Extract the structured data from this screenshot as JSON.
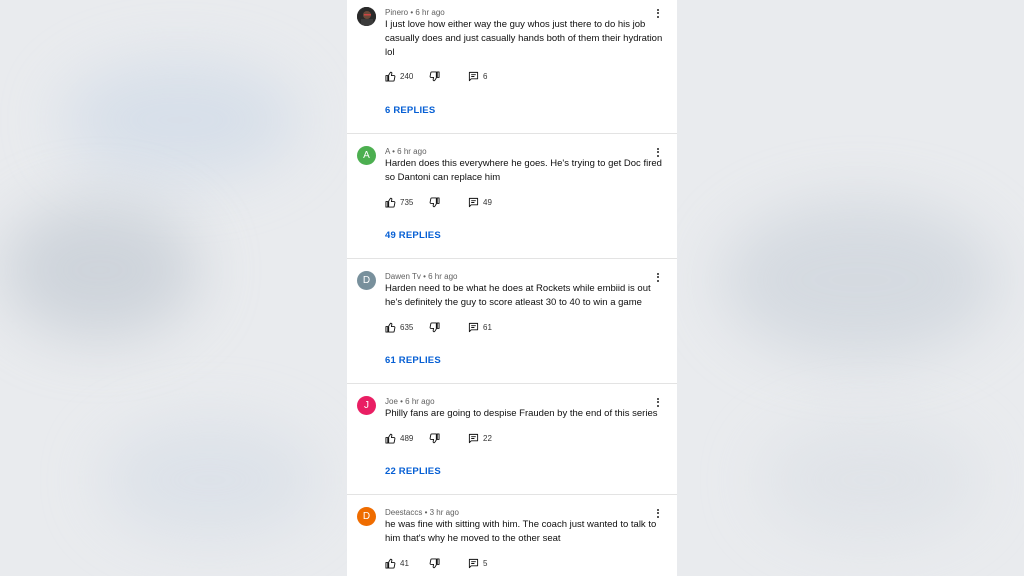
{
  "comments": [
    {
      "author": "Pinero",
      "time": "6 hr ago",
      "text": "I just love how either way the guy whos just there to do his job casually does and just casually hands both of them their hydration lol",
      "likes": "240",
      "reply_count": "6",
      "replies_label": "6 REPLIES",
      "avatar_letter": "",
      "avatar_color": "#2b2b2b"
    },
    {
      "author": "A",
      "time": "6 hr ago",
      "text": "Harden does this everywhere he goes. He's trying to get Doc fired so Dantoni can replace him",
      "likes": "735",
      "reply_count": "49",
      "replies_label": "49 REPLIES",
      "avatar_letter": "A",
      "avatar_color": "#4caf50"
    },
    {
      "author": "Dawen Tv",
      "time": "6 hr ago",
      "text": "Harden need to be what he does at Rockets while embiid is out he's definitely the guy to score atleast 30 to 40 to win a game",
      "likes": "635",
      "reply_count": "61",
      "replies_label": "61 REPLIES",
      "avatar_letter": "D",
      "avatar_color": "#78909c"
    },
    {
      "author": "Joe",
      "time": "6 hr ago",
      "text": "Philly fans are going to despise Frauden by the end of this series",
      "likes": "489",
      "reply_count": "22",
      "replies_label": "22 REPLIES",
      "avatar_letter": "J",
      "avatar_color": "#e91e63"
    },
    {
      "author": "Deestaccs",
      "time": "3 hr ago",
      "text": "he was fine with sitting with him. The coach just wanted to talk to him that's why he moved to the other seat",
      "likes": "41",
      "reply_count": "5",
      "avatar_letter": "D",
      "avatar_color": "#ef6c00"
    }
  ],
  "separator": " • "
}
